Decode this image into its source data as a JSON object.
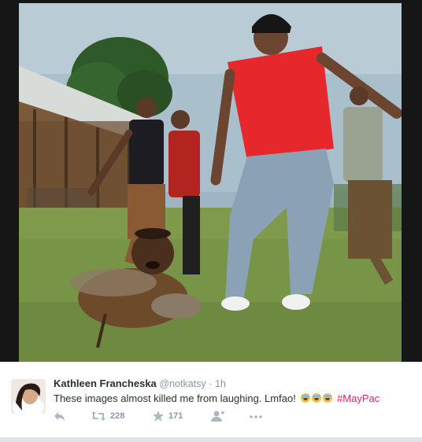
{
  "tweet": {
    "display_name": "Kathleen Francheska",
    "handle": "@notkatsy",
    "separator": "·",
    "time": "1h",
    "text": "These images almost killed me from laughing. Lmfao!",
    "emoji_count": 3,
    "emoji_name": "face-with-tears-of-joy",
    "hashtag": "#MayPac",
    "retweet_count": "228",
    "favorite_count": "171"
  },
  "colors": {
    "hashtag": "#e0245e",
    "text": "#292f33",
    "muted": "#8899a6",
    "action_icons": "#aab8c2",
    "background": "#161616"
  },
  "icons": [
    "reply-icon",
    "retweet-icon",
    "favorite-star-icon",
    "follow-icon",
    "more-icon"
  ]
}
